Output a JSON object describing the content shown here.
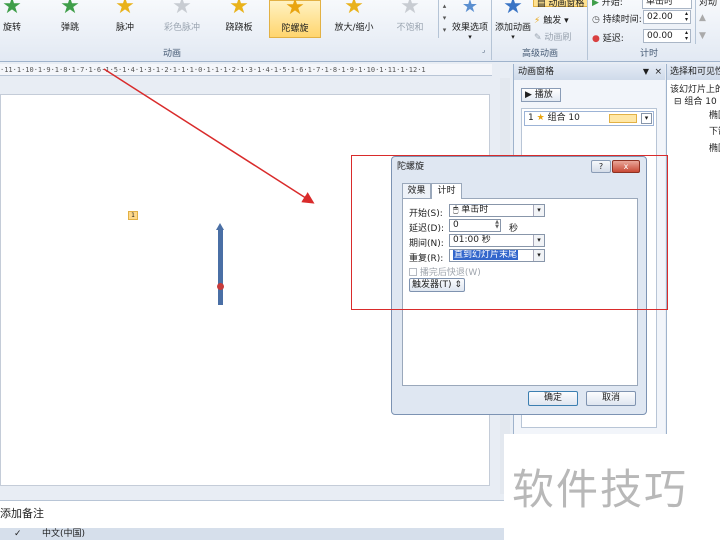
{
  "ribbon": {
    "effects": [
      {
        "label": "旋转",
        "state": "normal"
      },
      {
        "label": "弹跳",
        "state": "normal"
      },
      {
        "label": "脉冲",
        "state": "normal"
      },
      {
        "label": "彩色脉冲",
        "state": "disabled"
      },
      {
        "label": "跷跷板",
        "state": "normal"
      },
      {
        "label": "陀螺旋",
        "state": "selected"
      },
      {
        "label": "放大/缩小",
        "state": "normal"
      },
      {
        "label": "不饱和",
        "state": "disabled"
      }
    ],
    "effect_options_label": "效果选项",
    "animation_group_label": "动画",
    "add_animation_label": "添加动画",
    "animation_pane_label": "动画窗格",
    "trigger_label": "触发",
    "animation_painter_label": "动画刷",
    "advanced_group_label": "高级动画",
    "start_label": "开始:",
    "start_value": "单击时",
    "duration_label": "持续时间:",
    "duration_value": "02.00",
    "delay_label": "延迟:",
    "delay_value": "00.00",
    "reorder_label": "对动",
    "timing_group_label": "计时"
  },
  "ruler_text": "·11·1·10·1·9·1·8·1·7·1·6·1·5·1·4·1·3·1·2·1·1·1·0·1·1·1·2·1·3·1·4·1·5·1·6·1·7·1·8·1·9·1·10·1·11·1·12·1",
  "slide": {
    "animation_tag": "1"
  },
  "notes_placeholder": "添加备注",
  "status": {
    "language": "中文(中国)"
  },
  "animation_pane": {
    "title": "动画窗格",
    "play_label": "播放",
    "item": {
      "number": "1",
      "name": "组合 10"
    }
  },
  "selection_pane": {
    "title": "选择和可见性",
    "subtitle": "该幻灯片上的",
    "items": [
      "组合 10",
      "椭圆",
      "下箭",
      "椭圆"
    ]
  },
  "dialog": {
    "title": "陀螺旋",
    "help_label": "?",
    "close_label": "x",
    "tabs": [
      {
        "label": "效果",
        "active": false
      },
      {
        "label": "计时",
        "active": true
      }
    ],
    "start_label": "开始(S):",
    "start_value": "单击时",
    "delay_label": "延迟(D):",
    "delay_value": "0",
    "delay_unit": "秒",
    "period_label": "期间(N):",
    "period_value": "01:00 秒",
    "repeat_label": "重复(R):",
    "repeat_value": "直到幻灯片末尾",
    "rewind_label": "播完后快退(W)",
    "trigger_label": "触发器(T)",
    "ok_label": "确定",
    "cancel_label": "取消"
  },
  "watermark": "软件技巧",
  "colors": {
    "annotation_red": "#d92b2b",
    "selected_effect": "#ffd56e",
    "arrow_blue": "#4a6fa5",
    "highlight_blue": "#3366cc"
  }
}
